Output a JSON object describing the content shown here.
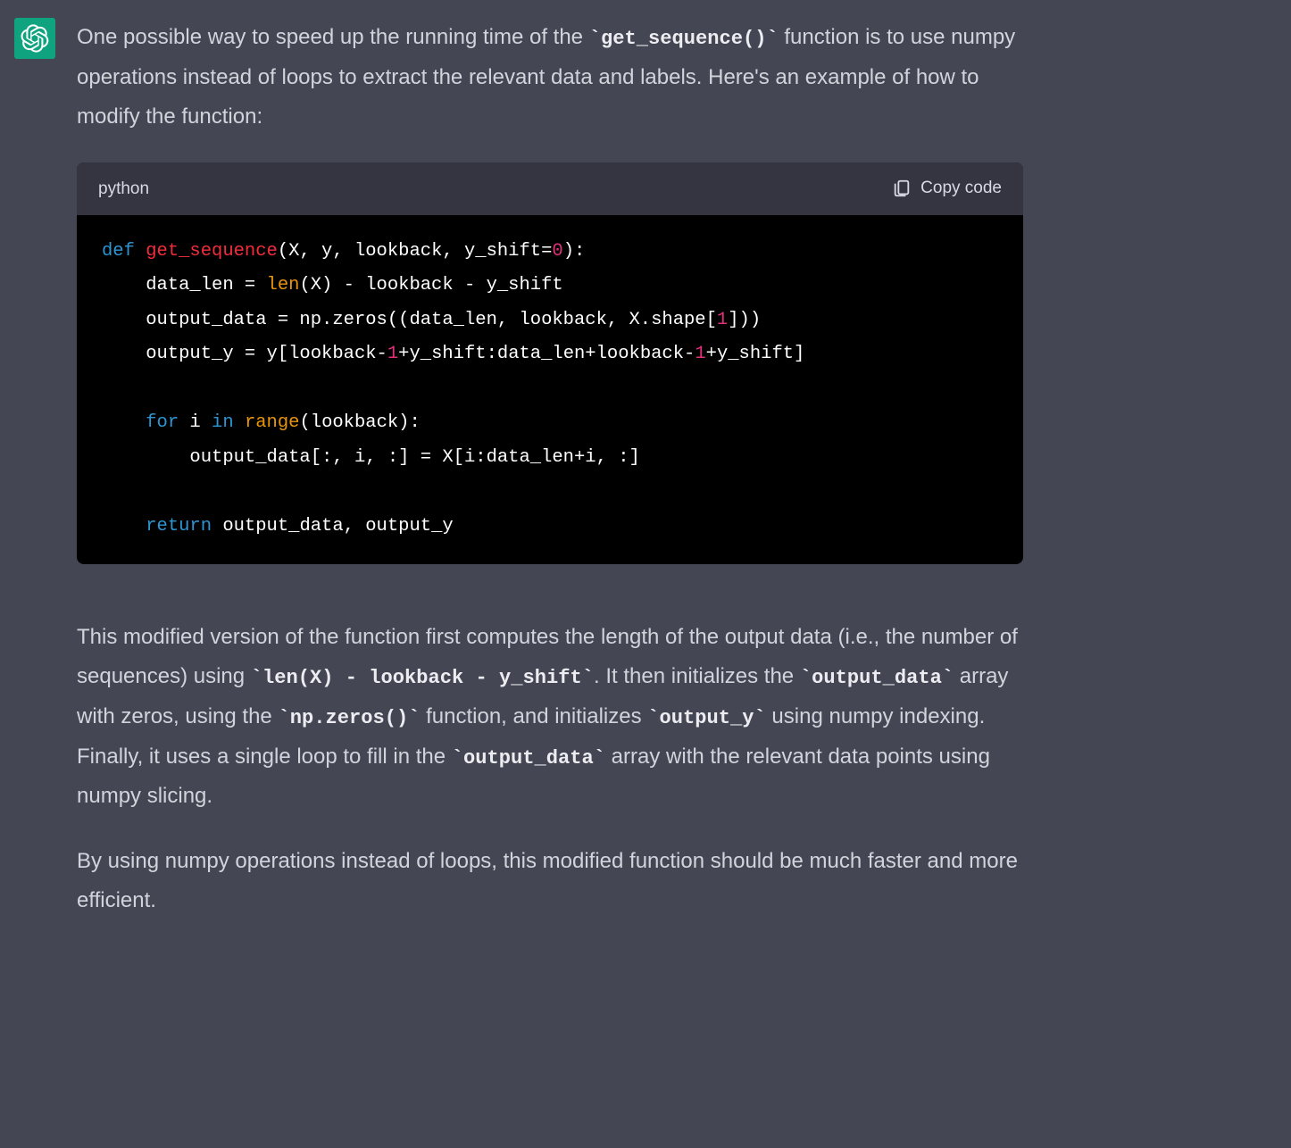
{
  "avatar": {
    "name": "chatgpt-logo",
    "color": "#10a37f"
  },
  "message": {
    "paragraph1": {
      "part1": "One possible way to speed up the running time of the ",
      "code1": "`get_sequence()`",
      "part2": " function is to use numpy operations instead of loops to extract the relevant data and labels. Here's an example of how to modify the function:"
    },
    "paragraph2": {
      "part1": "This modified version of the function first computes the length of the output data (i.e., the number of sequences) using ",
      "code1": "`len(X) - lookback - y_shift`",
      "part2": ". It then initializes the ",
      "code2": "`output_data`",
      "part3": " array with zeros, using the ",
      "code3": "`np.zeros()`",
      "part4": " function, and initializes ",
      "code4": "`output_y`",
      "part5": " using numpy indexing. Finally, it uses a single loop to fill in the ",
      "code5": "`output_data`",
      "part6": " array with the relevant data points using numpy slicing."
    },
    "paragraph3": "By using numpy operations instead of loops, this modified function should be much faster and more efficient."
  },
  "code_block": {
    "language": "python",
    "copy_label": "Copy code",
    "tokens": {
      "def": "def",
      "funcname": "get_sequence",
      "sig_open": "(X, y, lookback, y_shift=",
      "zero": "0",
      "sig_close": "):",
      "line2a": "    data_len = ",
      "len": "len",
      "line2b": "(X) - lookback - y_shift",
      "line3a": "    output_data = np.zeros((data_len, lookback, X.shape[",
      "one_a": "1",
      "line3b": "]))",
      "line4a": "    output_y = y[lookback-",
      "one_b": "1",
      "line4b": "+y_shift:data_len+lookback-",
      "one_c": "1",
      "line4c": "+y_shift]",
      "for": "for",
      "line6a": " i ",
      "in": "in",
      "line6b": " ",
      "range": "range",
      "line6c": "(lookback):",
      "line7": "        output_data[:, i, :] = X[i:data_len+i, :]",
      "return": "return",
      "line9": " output_data, output_y"
    }
  }
}
